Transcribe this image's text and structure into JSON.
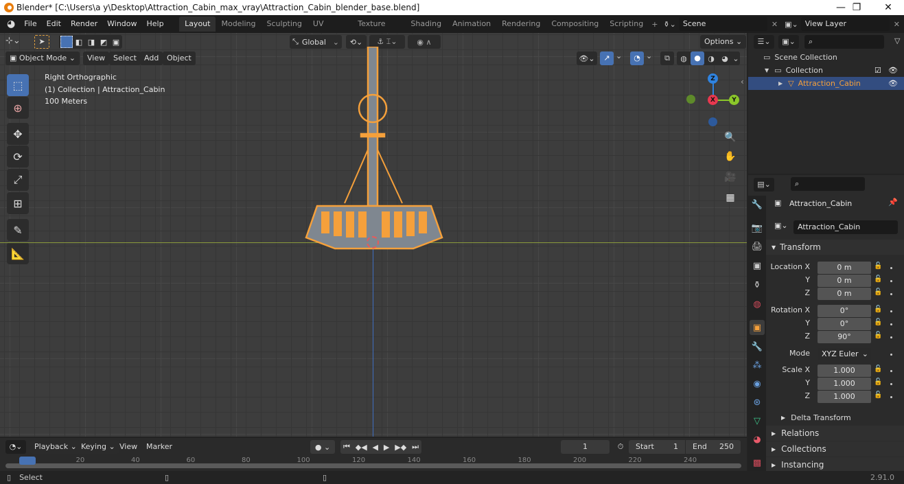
{
  "window": {
    "title": "Blender* [C:\\Users\\a y\\Desktop\\Attraction_Cabin_max_vray\\Attraction_Cabin_blender_base.blend]",
    "controls": {
      "minimize": "—",
      "restore": "❐",
      "close": "✕"
    }
  },
  "menubar": {
    "menus": [
      "File",
      "Edit",
      "Render",
      "Window",
      "Help"
    ],
    "workspaces": [
      "Layout",
      "Modeling",
      "Sculpting",
      "UV Editing",
      "Texture Paint",
      "Shading",
      "Animation",
      "Rendering",
      "Compositing",
      "Scripting"
    ],
    "active_workspace": "Layout",
    "add_workspace": "+",
    "scene": "Scene",
    "view_layer": "View Layer"
  },
  "viewport_header": {
    "mode": "Object Mode",
    "menus": [
      "View",
      "Select",
      "Add",
      "Object"
    ],
    "transform_orientation": "Global",
    "options": "Options"
  },
  "viewport_overlay": {
    "view_name": "Right Orthographic",
    "collection_info": "(1) Collection | Attraction_Cabin",
    "scale": "100 Meters"
  },
  "gizmo": {
    "z": "Z",
    "x": "X",
    "y": "Y",
    "colors": {
      "x": "#e8384f",
      "y": "#8bc72a",
      "z": "#2f83e0"
    }
  },
  "outliner": {
    "root": "Scene Collection",
    "collection": "Collection",
    "object": "Attraction_Cabin"
  },
  "properties": {
    "object_name": "Attraction_Cabin",
    "datablock_name": "Attraction_Cabin",
    "transform_label": "Transform",
    "location": {
      "label": "Location X",
      "x": "0 m",
      "y": "0 m",
      "z": "0 m"
    },
    "rotation": {
      "label": "Rotation X",
      "x": "0°",
      "y": "0°",
      "z": "90°"
    },
    "mode": {
      "label": "Mode",
      "value": "XYZ Euler"
    },
    "scale": {
      "label": "Scale X",
      "x": "1.000",
      "y": "1.000",
      "z": "1.000"
    },
    "axis_labels": {
      "y": "Y",
      "z": "Z"
    },
    "subpanels": [
      "Delta Transform"
    ],
    "panels": [
      "Relations",
      "Collections",
      "Instancing"
    ]
  },
  "timeline": {
    "menus": [
      "Playback",
      "Keying",
      "View",
      "Marker"
    ],
    "current_frame": "1",
    "start_label": "Start",
    "start": "1",
    "end_label": "End",
    "end": "250",
    "ruler": [
      "1",
      "20",
      "40",
      "60",
      "80",
      "100",
      "120",
      "140",
      "160",
      "180",
      "200",
      "220",
      "240"
    ]
  },
  "statusbar": {
    "hint": "Select",
    "version": "2.91.0"
  },
  "colors": {
    "accent": "#4772b3",
    "selection": "#f5a03b",
    "x_axis": "#a6b94a"
  }
}
